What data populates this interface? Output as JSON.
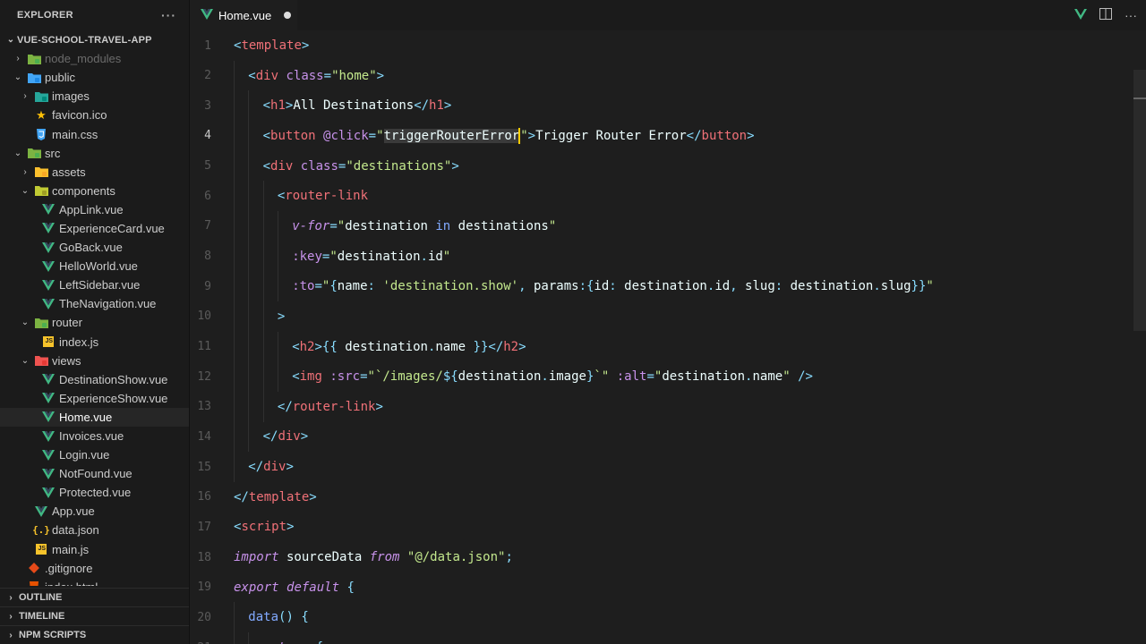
{
  "explorer": {
    "title": "EXPLORER",
    "more": "···",
    "project": "VUE-SCHOOL-TRAVEL-APP",
    "items": [
      {
        "label": "node_modules",
        "depth": 1,
        "chev": "›",
        "icon": "folder-green",
        "dim": true
      },
      {
        "label": "public",
        "depth": 1,
        "chev": "⌄",
        "icon": "folder-blue"
      },
      {
        "label": "images",
        "depth": 2,
        "chev": "›",
        "icon": "folder-teal"
      },
      {
        "label": "favicon.ico",
        "depth": 2,
        "chev": "",
        "icon": "star"
      },
      {
        "label": "main.css",
        "depth": 2,
        "chev": "",
        "icon": "css"
      },
      {
        "label": "src",
        "depth": 1,
        "chev": "⌄",
        "icon": "folder-green"
      },
      {
        "label": "assets",
        "depth": 2,
        "chev": "›",
        "icon": "folder-yellow"
      },
      {
        "label": "components",
        "depth": 2,
        "chev": "⌄",
        "icon": "folder-olive"
      },
      {
        "label": "AppLink.vue",
        "depth": 3,
        "chev": "",
        "icon": "vue"
      },
      {
        "label": "ExperienceCard.vue",
        "depth": 3,
        "chev": "",
        "icon": "vue"
      },
      {
        "label": "GoBack.vue",
        "depth": 3,
        "chev": "",
        "icon": "vue"
      },
      {
        "label": "HelloWorld.vue",
        "depth": 3,
        "chev": "",
        "icon": "vue"
      },
      {
        "label": "LeftSidebar.vue",
        "depth": 3,
        "chev": "",
        "icon": "vue"
      },
      {
        "label": "TheNavigation.vue",
        "depth": 3,
        "chev": "",
        "icon": "vue"
      },
      {
        "label": "router",
        "depth": 2,
        "chev": "⌄",
        "icon": "folder-green"
      },
      {
        "label": "index.js",
        "depth": 3,
        "chev": "",
        "icon": "js"
      },
      {
        "label": "views",
        "depth": 2,
        "chev": "⌄",
        "icon": "folder-red"
      },
      {
        "label": "DestinationShow.vue",
        "depth": 3,
        "chev": "",
        "icon": "vue"
      },
      {
        "label": "ExperienceShow.vue",
        "depth": 3,
        "chev": "",
        "icon": "vue"
      },
      {
        "label": "Home.vue",
        "depth": 3,
        "chev": "",
        "icon": "vue",
        "active": true
      },
      {
        "label": "Invoices.vue",
        "depth": 3,
        "chev": "",
        "icon": "vue"
      },
      {
        "label": "Login.vue",
        "depth": 3,
        "chev": "",
        "icon": "vue"
      },
      {
        "label": "NotFound.vue",
        "depth": 3,
        "chev": "",
        "icon": "vue"
      },
      {
        "label": "Protected.vue",
        "depth": 3,
        "chev": "",
        "icon": "vue"
      },
      {
        "label": "App.vue",
        "depth": 2,
        "chev": "",
        "icon": "vue"
      },
      {
        "label": "data.json",
        "depth": 2,
        "chev": "",
        "icon": "json"
      },
      {
        "label": "main.js",
        "depth": 2,
        "chev": "",
        "icon": "js"
      },
      {
        "label": ".gitignore",
        "depth": 1,
        "chev": "",
        "icon": "git"
      },
      {
        "label": "index.html",
        "depth": 1,
        "chev": "",
        "icon": "html"
      }
    ],
    "sections": [
      "OUTLINE",
      "TIMELINE",
      "NPM SCRIPTS"
    ]
  },
  "tab": {
    "label": "Home.vue",
    "modified": true
  },
  "current_line": 4,
  "lines": [
    {
      "n": 1,
      "indent": 0,
      "tokens": [
        [
          "br",
          "<"
        ],
        [
          "tag",
          "template"
        ],
        [
          "br",
          ">"
        ]
      ]
    },
    {
      "n": 2,
      "indent": 1,
      "tokens": [
        [
          "br",
          "<"
        ],
        [
          "tag",
          "div"
        ],
        [
          "txt",
          " "
        ],
        [
          "attr",
          "class"
        ],
        [
          "op",
          "="
        ],
        [
          "str",
          "\"home\""
        ],
        [
          "br",
          ">"
        ]
      ]
    },
    {
      "n": 3,
      "indent": 2,
      "tokens": [
        [
          "br",
          "<"
        ],
        [
          "tag",
          "h1"
        ],
        [
          "br",
          ">"
        ],
        [
          "txt",
          "All Destinations"
        ],
        [
          "br",
          "</"
        ],
        [
          "tag",
          "h1"
        ],
        [
          "br",
          ">"
        ]
      ]
    },
    {
      "n": 4,
      "indent": 2,
      "tokens": [
        [
          "br",
          "<"
        ],
        [
          "tag",
          "button"
        ],
        [
          "txt",
          " "
        ],
        [
          "attr",
          "@click"
        ],
        [
          "op",
          "="
        ],
        [
          "str",
          "\""
        ],
        [
          "hl",
          "triggerRouterError"
        ],
        [
          "caret",
          ""
        ],
        [
          "str",
          "\""
        ],
        [
          "br",
          ">"
        ],
        [
          "txt",
          "Trigger Router Error"
        ],
        [
          "br",
          "</"
        ],
        [
          "tag",
          "button"
        ],
        [
          "br",
          ">"
        ]
      ]
    },
    {
      "n": 5,
      "indent": 2,
      "tokens": [
        [
          "br",
          "<"
        ],
        [
          "tag",
          "div"
        ],
        [
          "txt",
          " "
        ],
        [
          "attr",
          "class"
        ],
        [
          "op",
          "="
        ],
        [
          "str",
          "\"destinations\""
        ],
        [
          "br",
          ">"
        ]
      ]
    },
    {
      "n": 6,
      "indent": 3,
      "tokens": [
        [
          "br",
          "<"
        ],
        [
          "tag",
          "router-link"
        ]
      ]
    },
    {
      "n": 7,
      "indent": 4,
      "tokens": [
        [
          "kw",
          "v-for"
        ],
        [
          "op",
          "="
        ],
        [
          "str",
          "\""
        ],
        [
          "txt",
          "destination "
        ],
        [
          "fn",
          "in"
        ],
        [
          "txt",
          " destinations"
        ],
        [
          "str",
          "\""
        ]
      ]
    },
    {
      "n": 8,
      "indent": 4,
      "tokens": [
        [
          "attr",
          ":key"
        ],
        [
          "op",
          "="
        ],
        [
          "str",
          "\""
        ],
        [
          "txt",
          "destination"
        ],
        [
          "op",
          "."
        ],
        [
          "txt",
          "id"
        ],
        [
          "str",
          "\""
        ]
      ]
    },
    {
      "n": 9,
      "indent": 4,
      "tokens": [
        [
          "attr",
          ":to"
        ],
        [
          "op",
          "="
        ],
        [
          "str",
          "\""
        ],
        [
          "op",
          "{"
        ],
        [
          "txt",
          "name"
        ],
        [
          "op",
          ":"
        ],
        [
          "txt",
          " "
        ],
        [
          "str",
          "'destination.show'"
        ],
        [
          "op",
          ","
        ],
        [
          "txt",
          " params"
        ],
        [
          "op",
          ":{"
        ],
        [
          "txt",
          "id"
        ],
        [
          "op",
          ":"
        ],
        [
          "txt",
          " destination"
        ],
        [
          "op",
          "."
        ],
        [
          "txt",
          "id"
        ],
        [
          "op",
          ","
        ],
        [
          "txt",
          " slug"
        ],
        [
          "op",
          ":"
        ],
        [
          "txt",
          " destination"
        ],
        [
          "op",
          "."
        ],
        [
          "txt",
          "slug"
        ],
        [
          "op",
          "}}"
        ],
        [
          "str",
          "\""
        ]
      ]
    },
    {
      "n": 10,
      "indent": 3,
      "tokens": [
        [
          "br",
          ">"
        ]
      ]
    },
    {
      "n": 11,
      "indent": 4,
      "tokens": [
        [
          "br",
          "<"
        ],
        [
          "tag",
          "h2"
        ],
        [
          "br",
          ">"
        ],
        [
          "op",
          "{{"
        ],
        [
          "txt",
          " destination"
        ],
        [
          "op",
          "."
        ],
        [
          "txt",
          "name "
        ],
        [
          "op",
          "}}"
        ],
        [
          "br",
          "</"
        ],
        [
          "tag",
          "h2"
        ],
        [
          "br",
          ">"
        ]
      ]
    },
    {
      "n": 12,
      "indent": 4,
      "tokens": [
        [
          "br",
          "<"
        ],
        [
          "tag",
          "img"
        ],
        [
          "txt",
          " "
        ],
        [
          "attr",
          ":src"
        ],
        [
          "op",
          "="
        ],
        [
          "str",
          "\"`/images/"
        ],
        [
          "op",
          "${"
        ],
        [
          "txt",
          "destination"
        ],
        [
          "op",
          "."
        ],
        [
          "txt",
          "image"
        ],
        [
          "op",
          "}"
        ],
        [
          "str",
          "`\""
        ],
        [
          "txt",
          " "
        ],
        [
          "attr",
          ":alt"
        ],
        [
          "op",
          "="
        ],
        [
          "str",
          "\""
        ],
        [
          "txt",
          "destination"
        ],
        [
          "op",
          "."
        ],
        [
          "txt",
          "name"
        ],
        [
          "str",
          "\""
        ],
        [
          "txt",
          " "
        ],
        [
          "br",
          "/>"
        ]
      ]
    },
    {
      "n": 13,
      "indent": 3,
      "tokens": [
        [
          "br",
          "</"
        ],
        [
          "tag",
          "router-link"
        ],
        [
          "br",
          ">"
        ]
      ]
    },
    {
      "n": 14,
      "indent": 2,
      "tokens": [
        [
          "br",
          "</"
        ],
        [
          "tag",
          "div"
        ],
        [
          "br",
          ">"
        ]
      ]
    },
    {
      "n": 15,
      "indent": 1,
      "tokens": [
        [
          "br",
          "</"
        ],
        [
          "tag",
          "div"
        ],
        [
          "br",
          ">"
        ]
      ]
    },
    {
      "n": 16,
      "indent": 0,
      "tokens": [
        [
          "br",
          "</"
        ],
        [
          "tag",
          "template"
        ],
        [
          "br",
          ">"
        ]
      ]
    },
    {
      "n": 17,
      "indent": 0,
      "tokens": [
        [
          "br",
          "<"
        ],
        [
          "tag",
          "script"
        ],
        [
          "br",
          ">"
        ]
      ]
    },
    {
      "n": 18,
      "indent": 0,
      "tokens": [
        [
          "kw",
          "import"
        ],
        [
          "txt",
          " sourceData "
        ],
        [
          "kw",
          "from"
        ],
        [
          "txt",
          " "
        ],
        [
          "str",
          "\"@/data.json\""
        ],
        [
          "op",
          ";"
        ]
      ]
    },
    {
      "n": 19,
      "indent": 0,
      "tokens": [
        [
          "kw",
          "export"
        ],
        [
          "txt",
          " "
        ],
        [
          "kw",
          "default"
        ],
        [
          "txt",
          " "
        ],
        [
          "op",
          "{"
        ]
      ]
    },
    {
      "n": 20,
      "indent": 1,
      "tokens": [
        [
          "fn",
          "data"
        ],
        [
          "op",
          "()"
        ],
        [
          "txt",
          " "
        ],
        [
          "op",
          "{"
        ]
      ]
    },
    {
      "n": 21,
      "indent": 2,
      "tokens": [
        [
          "kw",
          "return"
        ],
        [
          "txt",
          " "
        ],
        [
          "op",
          "{"
        ]
      ]
    }
  ]
}
